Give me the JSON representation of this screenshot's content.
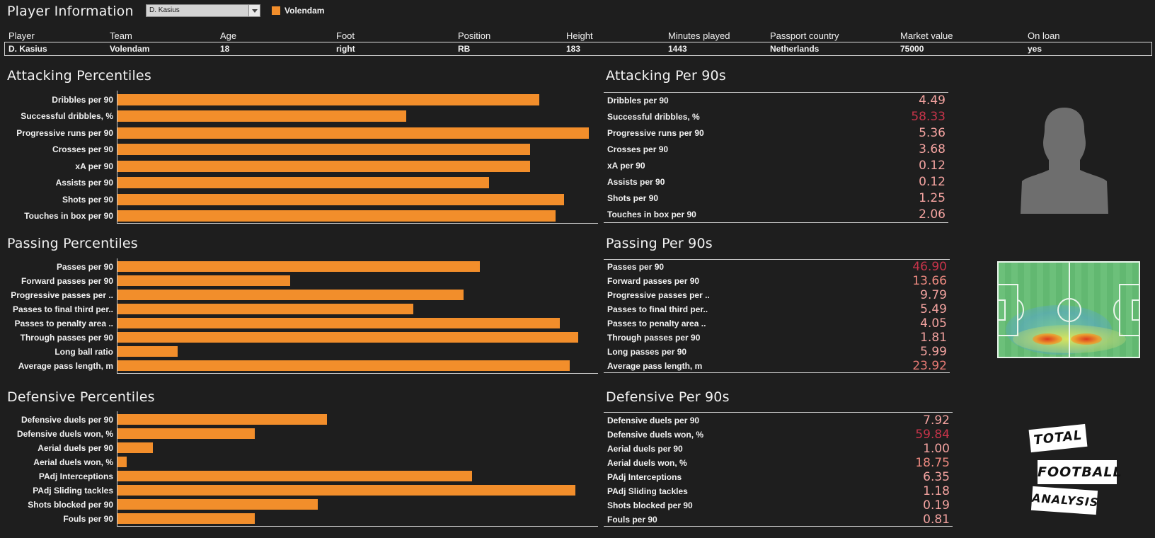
{
  "header": {
    "title": "Player Information",
    "player_select_value": "D. Kasius",
    "legend_label": "Volendam",
    "legend_color": "#f28e2b"
  },
  "info": {
    "headers": [
      "Player",
      "Team",
      "Age",
      "Foot",
      "Position",
      "Height",
      "Minutes played",
      "Passport country",
      "Market value",
      "On loan"
    ],
    "values": [
      "D. Kasius",
      "Volendam",
      "18",
      "right",
      "RB",
      "183",
      "1443",
      "Netherlands",
      "75000",
      "yes"
    ]
  },
  "attacking_percentiles": {
    "title": "Attacking Percentiles",
    "labels": [
      "Dribbles per 90",
      "Successful dribbles, %",
      "Progressive runs per 90",
      "Crosses per 90",
      "xA per 90",
      "Assists per 90",
      "Shots per 90",
      "Touches in box per 90"
    ]
  },
  "passing_percentiles": {
    "title": "Passing Percentiles",
    "labels": [
      "Passes per 90",
      "Forward passes per 90",
      "Progressive passes per ..",
      "Passes to final third per..",
      "Passes to penalty area ..",
      "Through passes per 90",
      "Long ball ratio",
      "Average pass length, m"
    ]
  },
  "defensive_percentiles": {
    "title": "Defensive Percentiles",
    "labels": [
      "Defensive duels per 90",
      "Defensive duels won, %",
      "Aerial duels per 90",
      "Aerial duels won, %",
      "PAdj Interceptions",
      "PAdj Sliding tackles",
      "Shots blocked per 90",
      "Fouls per 90"
    ]
  },
  "attacking_per90": {
    "title": "Attacking Per 90s",
    "labels": [
      "Dribbles per 90",
      "Successful dribbles, %",
      "Progressive runs per 90",
      "Crosses per 90",
      "xA per 90",
      "Assists per 90",
      "Shots per 90",
      "Touches in box per 90"
    ],
    "values": [
      "4.49",
      "58.33",
      "5.36",
      "3.68",
      "0.12",
      "0.12",
      "1.25",
      "2.06"
    ],
    "colors": [
      "#f4a3a0",
      "#c8344a",
      "#f4a3a0",
      "#f4a3a0",
      "#f4a3a0",
      "#f4a3a0",
      "#f4a3a0",
      "#f4a3a0"
    ]
  },
  "passing_per90": {
    "title": "Passing Per 90s",
    "labels": [
      "Passes per 90",
      "Forward passes per 90",
      "Progressive passes per ..",
      "Passes to final third per..",
      "Passes to penalty area ..",
      "Through passes per 90",
      "Long passes per 90",
      "Average pass length, m"
    ],
    "values": [
      "46.90",
      "13.66",
      "9.79",
      "5.49",
      "4.05",
      "1.81",
      "5.99",
      "23.92"
    ],
    "colors": [
      "#c8344a",
      "#ee8a80",
      "#f4a3a0",
      "#f4a3a0",
      "#f4a3a0",
      "#f4a3a0",
      "#f4a3a0",
      "#e77a74"
    ]
  },
  "defensive_per90": {
    "title": "Defensive Per 90s",
    "labels": [
      "Defensive duels per 90",
      "Defensive duels won, %",
      "Aerial duels per 90",
      "Aerial duels won, %",
      "PAdj Interceptions",
      "PAdj Sliding tackles",
      "Shots blocked per 90",
      "Fouls per 90"
    ],
    "values": [
      "7.92",
      "59.84",
      "1.00",
      "18.75",
      "6.35",
      "1.18",
      "0.19",
      "0.81"
    ],
    "colors": [
      "#f4a3a0",
      "#c8344a",
      "#f4a3a0",
      "#ee8a80",
      "#f4a3a0",
      "#f4a3a0",
      "#f4a3a0",
      "#f4a3a0"
    ]
  },
  "chart_data": [
    {
      "type": "bar",
      "orientation": "horizontal",
      "title": "Attacking Percentiles",
      "categories": [
        "Dribbles per 90",
        "Successful dribbles, %",
        "Progressive runs per 90",
        "Crosses per 90",
        "xA per 90",
        "Assists per 90",
        "Shots per 90",
        "Touches in box per 90"
      ],
      "values": [
        89.5,
        61.2,
        100,
        87.6,
        87.6,
        78.8,
        94.7,
        93.0
      ],
      "xlim": [
        0,
        100
      ],
      "color": "#f28e2b"
    },
    {
      "type": "bar",
      "orientation": "horizontal",
      "title": "Passing Percentiles",
      "categories": [
        "Passes per 90",
        "Forward passes per 90",
        "Progressive passes per ..",
        "Passes to final third per..",
        "Passes to penalty area ..",
        "Through passes per 90",
        "Long ball ratio",
        "Average pass length, m"
      ],
      "values": [
        76.9,
        36.6,
        73.4,
        62.8,
        93.8,
        97.8,
        12.8,
        96.0
      ],
      "xlim": [
        0,
        100
      ],
      "color": "#f28e2b"
    },
    {
      "type": "bar",
      "orientation": "horizontal",
      "title": "Defensive Percentiles",
      "categories": [
        "Defensive duels per 90",
        "Defensive duels won, %",
        "Aerial duels per 90",
        "Aerial duels won, %",
        "PAdj Interceptions",
        "PAdj Sliding tackles",
        "Shots blocked per 90",
        "Fouls per 90"
      ],
      "values": [
        44.4,
        29.1,
        7.5,
        1.9,
        75.3,
        97.2,
        42.5,
        29.1
      ],
      "xlim": [
        0,
        100
      ],
      "color": "#f28e2b"
    }
  ],
  "logo": {
    "line1": "TOTAL",
    "line2": "FOOTBALL",
    "line3": "ANALYSIS"
  }
}
